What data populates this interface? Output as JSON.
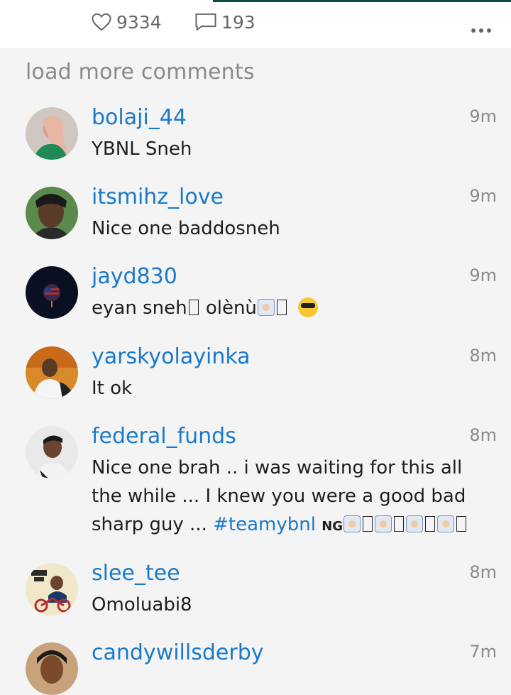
{
  "actions": {
    "likes": "9334",
    "replies": "193"
  },
  "load_more": "load more comments",
  "comments": [
    {
      "username": "bolaji_44",
      "time": "9m",
      "text": "YBNL  Sneh"
    },
    {
      "username": "itsmihz_love",
      "time": "9m",
      "text": "Nice one baddosneh"
    },
    {
      "username": "jayd830",
      "time": "9m",
      "text": "eyan sneh",
      "text2": " olènù"
    },
    {
      "username": "yarskyolayinka",
      "time": "8m",
      "text": "It ok"
    },
    {
      "username": "federal_funds",
      "time": "8m",
      "line1": "Nice one brah .. i was waiting for this all",
      "line2": "the while ... I knew you were a good bad",
      "line3": "sharp guy ... ",
      "hashtag": "#teamybnl",
      "flag": "NG"
    },
    {
      "username": "slee_tee",
      "time": "8m",
      "text": "Omoluabi8"
    },
    {
      "username": "candywillsderby",
      "time": "7m",
      "text": ""
    }
  ]
}
